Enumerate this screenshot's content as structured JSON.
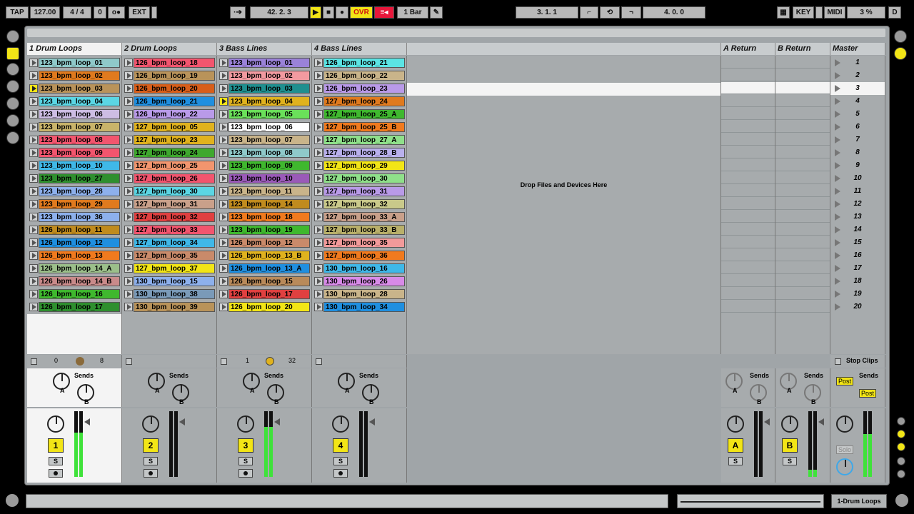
{
  "transport": {
    "tap": "TAP",
    "tempo": "127.00",
    "signature": "4 / 4",
    "nudge": "0",
    "ext": "EXT",
    "position": "42.  2.  3",
    "ovr": "OVR",
    "quantize": "1 Bar",
    "loop_start": "3.  1.  1",
    "loop_length": "4.  0.  0",
    "key": "KEY",
    "midi": "MIDI",
    "cpu": "3 %",
    "disk": "D"
  },
  "tracks": [
    {
      "name": "1 Drum Loops",
      "selected": true,
      "number": "1",
      "send_a": "A",
      "send_b": "B",
      "sends": "Sends",
      "io_left": "0",
      "io_right": "8",
      "clips": [
        {
          "n": "123_bpm_loop_01",
          "c": "#8fc9c9"
        },
        {
          "n": "123_bpm_loop_02",
          "c": "#e07a1e"
        },
        {
          "n": "123_bpm_loop_03",
          "c": "#b9935a",
          "play": true
        },
        {
          "n": "123_bpm_loop_04",
          "c": "#5bd6e4"
        },
        {
          "n": "123_bpm_loop_06",
          "c": "#cdbde4"
        },
        {
          "n": "123_bpm_loop_07",
          "c": "#c9b46a"
        },
        {
          "n": "123_bpm_loop_08",
          "c": "#f2556e"
        },
        {
          "n": "123_bpm_loop_09",
          "c": "#f2556e"
        },
        {
          "n": "123_bpm_loop_10",
          "c": "#3fb8e8"
        },
        {
          "n": "123_bpm_loop_27",
          "c": "#2e8f2e"
        },
        {
          "n": "123_bpm_loop_28",
          "c": "#8db0ec"
        },
        {
          "n": "123_bpm_loop_29",
          "c": "#e07a1e"
        },
        {
          "n": "123_bpm_loop_36",
          "c": "#8db0ec"
        },
        {
          "n": "126_bpm_loop_11",
          "c": "#c08b1e"
        },
        {
          "n": "126_bpm_loop_12",
          "c": "#1f8fe0"
        },
        {
          "n": "126_bpm_loop_13",
          "c": "#f07a1e"
        },
        {
          "n": "126_bpm_loop_14_A",
          "c": "#9bbf8a"
        },
        {
          "n": "126_bpm_loop_14_B",
          "c": "#c98a8a"
        },
        {
          "n": "126_bpm_loop_16",
          "c": "#3fb82e"
        },
        {
          "n": "126_bpm_loop_17",
          "c": "#2e8f2e"
        }
      ]
    },
    {
      "name": "2 Drum Loops",
      "selected": false,
      "number": "2",
      "send_a": "A",
      "send_b": "B",
      "sends": "Sends",
      "clips": [
        {
          "n": "126_bpm_loop_18",
          "c": "#f2556e"
        },
        {
          "n": "126_bpm_loop_19",
          "c": "#b9935a"
        },
        {
          "n": "126_bpm_loop_20",
          "c": "#d85e1a"
        },
        {
          "n": "126_bpm_loop_21",
          "c": "#1f8fe0"
        },
        {
          "n": "126_bpm_loop_22",
          "c": "#b99ae8"
        },
        {
          "n": "127_bpm_loop_05",
          "c": "#e0b21e"
        },
        {
          "n": "127_bpm_loop_23",
          "c": "#e0b21e"
        },
        {
          "n": "127_bpm_loop_24",
          "c": "#3fa82e"
        },
        {
          "n": "127_bpm_loop_25",
          "c": "#f2956e"
        },
        {
          "n": "127_bpm_loop_26",
          "c": "#f2556e"
        },
        {
          "n": "127_bpm_loop_30",
          "c": "#5bd6e4"
        },
        {
          "n": "127_bpm_loop_31",
          "c": "#c9a08a"
        },
        {
          "n": "127_bpm_loop_32",
          "c": "#e04040"
        },
        {
          "n": "127_bpm_loop_33",
          "c": "#f2556e"
        },
        {
          "n": "127_bpm_loop_34",
          "c": "#3fb8e8"
        },
        {
          "n": "127_bpm_loop_35",
          "c": "#c98a6a"
        },
        {
          "n": "127_bpm_loop_37",
          "c": "#f2e516"
        },
        {
          "n": "130_bpm_loop_15",
          "c": "#8db0ec"
        },
        {
          "n": "130_bpm_loop_38",
          "c": "#7a9ab8"
        },
        {
          "n": "130_bpm_loop_39",
          "c": "#b9935a"
        }
      ]
    },
    {
      "name": "3 Bass Lines",
      "selected": false,
      "number": "3",
      "send_a": "A",
      "send_b": "B",
      "sends": "Sends",
      "io_left": "1",
      "io_right": "32",
      "clips": [
        {
          "n": "123_bpm_loop_01",
          "c": "#9a82d8"
        },
        {
          "n": "123_bpm_loop_02",
          "c": "#f29aa0"
        },
        {
          "n": "123_bpm_loop_03",
          "c": "#1f8f8f"
        },
        {
          "n": "123_bpm_loop_04",
          "c": "#e0b21e",
          "play": true
        },
        {
          "n": "123_bpm_loop_05",
          "c": "#6ae05a"
        },
        {
          "n": "123_bpm_loop_06",
          "c": "#ffffff"
        },
        {
          "n": "123_bpm_loop_07",
          "c": "#c9b48a"
        },
        {
          "n": "123_bpm_loop_08",
          "c": "#8fc9c9"
        },
        {
          "n": "123_bpm_loop_09",
          "c": "#3fb82e"
        },
        {
          "n": "123_bpm_loop_10",
          "c": "#9a5ab8"
        },
        {
          "n": "123_bpm_loop_11",
          "c": "#c9b48a"
        },
        {
          "n": "123_bpm_loop_14",
          "c": "#c08b1e"
        },
        {
          "n": "123_bpm_loop_18",
          "c": "#f07a1e"
        },
        {
          "n": "123_bpm_loop_19",
          "c": "#3fb82e"
        },
        {
          "n": "126_bpm_loop_12",
          "c": "#c98a6a"
        },
        {
          "n": "126_bpm_loop_13_B",
          "c": "#e0b21e"
        },
        {
          "n": "126_bpm_loop_13_A",
          "c": "#1f8fe0"
        },
        {
          "n": "126_bpm_loop_15",
          "c": "#b98a5a"
        },
        {
          "n": "126_bpm_loop_17",
          "c": "#e04040"
        },
        {
          "n": "126_bpm_loop_20",
          "c": "#f2e516"
        }
      ]
    },
    {
      "name": "4 Bass Lines",
      "selected": false,
      "number": "4",
      "send_a": "A",
      "send_b": "B",
      "sends": "Sends",
      "clips": [
        {
          "n": "126_bpm_loop_21",
          "c": "#5be4e4"
        },
        {
          "n": "126_bpm_loop_22",
          "c": "#c9b48a"
        },
        {
          "n": "126_bpm_loop_23",
          "c": "#b99ae8"
        },
        {
          "n": "127_bpm_loop_24",
          "c": "#e07a1e"
        },
        {
          "n": "127_bpm_loop_25_A",
          "c": "#3fb82e"
        },
        {
          "n": "127_bpm_loop_25_B",
          "c": "#f07a1e"
        },
        {
          "n": "127_bpm_loop_27_A",
          "c": "#8fe08a"
        },
        {
          "n": "127_bpm_loop_28_B",
          "c": "#b9b0ec"
        },
        {
          "n": "127_bpm_loop_29",
          "c": "#f2e516"
        },
        {
          "n": "127_bpm_loop_30",
          "c": "#8fe08a"
        },
        {
          "n": "127_bpm_loop_31",
          "c": "#b99ae8"
        },
        {
          "n": "127_bpm_loop_32",
          "c": "#c9c98a"
        },
        {
          "n": "127_bpm_loop_33_A",
          "c": "#c9a08a"
        },
        {
          "n": "127_bpm_loop_33_B",
          "c": "#b9b06a"
        },
        {
          "n": "127_bpm_loop_35",
          "c": "#f29a9a"
        },
        {
          "n": "127_bpm_loop_36",
          "c": "#f07a1e"
        },
        {
          "n": "130_bpm_loop_16",
          "c": "#3fb8e8"
        },
        {
          "n": "130_bpm_loop_26",
          "c": "#d88ae8"
        },
        {
          "n": "130_bpm_loop_28",
          "c": "#c9b48a"
        },
        {
          "n": "130_bpm_loop_34",
          "c": "#1f8fe0"
        }
      ]
    }
  ],
  "drop_text": "Drop Files and Devices Here",
  "returns": [
    {
      "name": "A Return",
      "letter": "A",
      "sends": "Sends"
    },
    {
      "name": "B Return",
      "letter": "B",
      "sends": "Sends"
    }
  ],
  "master": {
    "name": "Master",
    "stop_clips": "Stop Clips",
    "sends": "Sends",
    "post1": "Post",
    "post2": "Post",
    "solo": "Solo",
    "scenes": [
      "1",
      "2",
      "3",
      "4",
      "5",
      "6",
      "7",
      "8",
      "9",
      "10",
      "11",
      "12",
      "13",
      "14",
      "15",
      "16",
      "17",
      "18",
      "19",
      "20"
    ]
  },
  "bottom": {
    "track_label": "1-Drum Loops"
  },
  "solo_label": "S"
}
